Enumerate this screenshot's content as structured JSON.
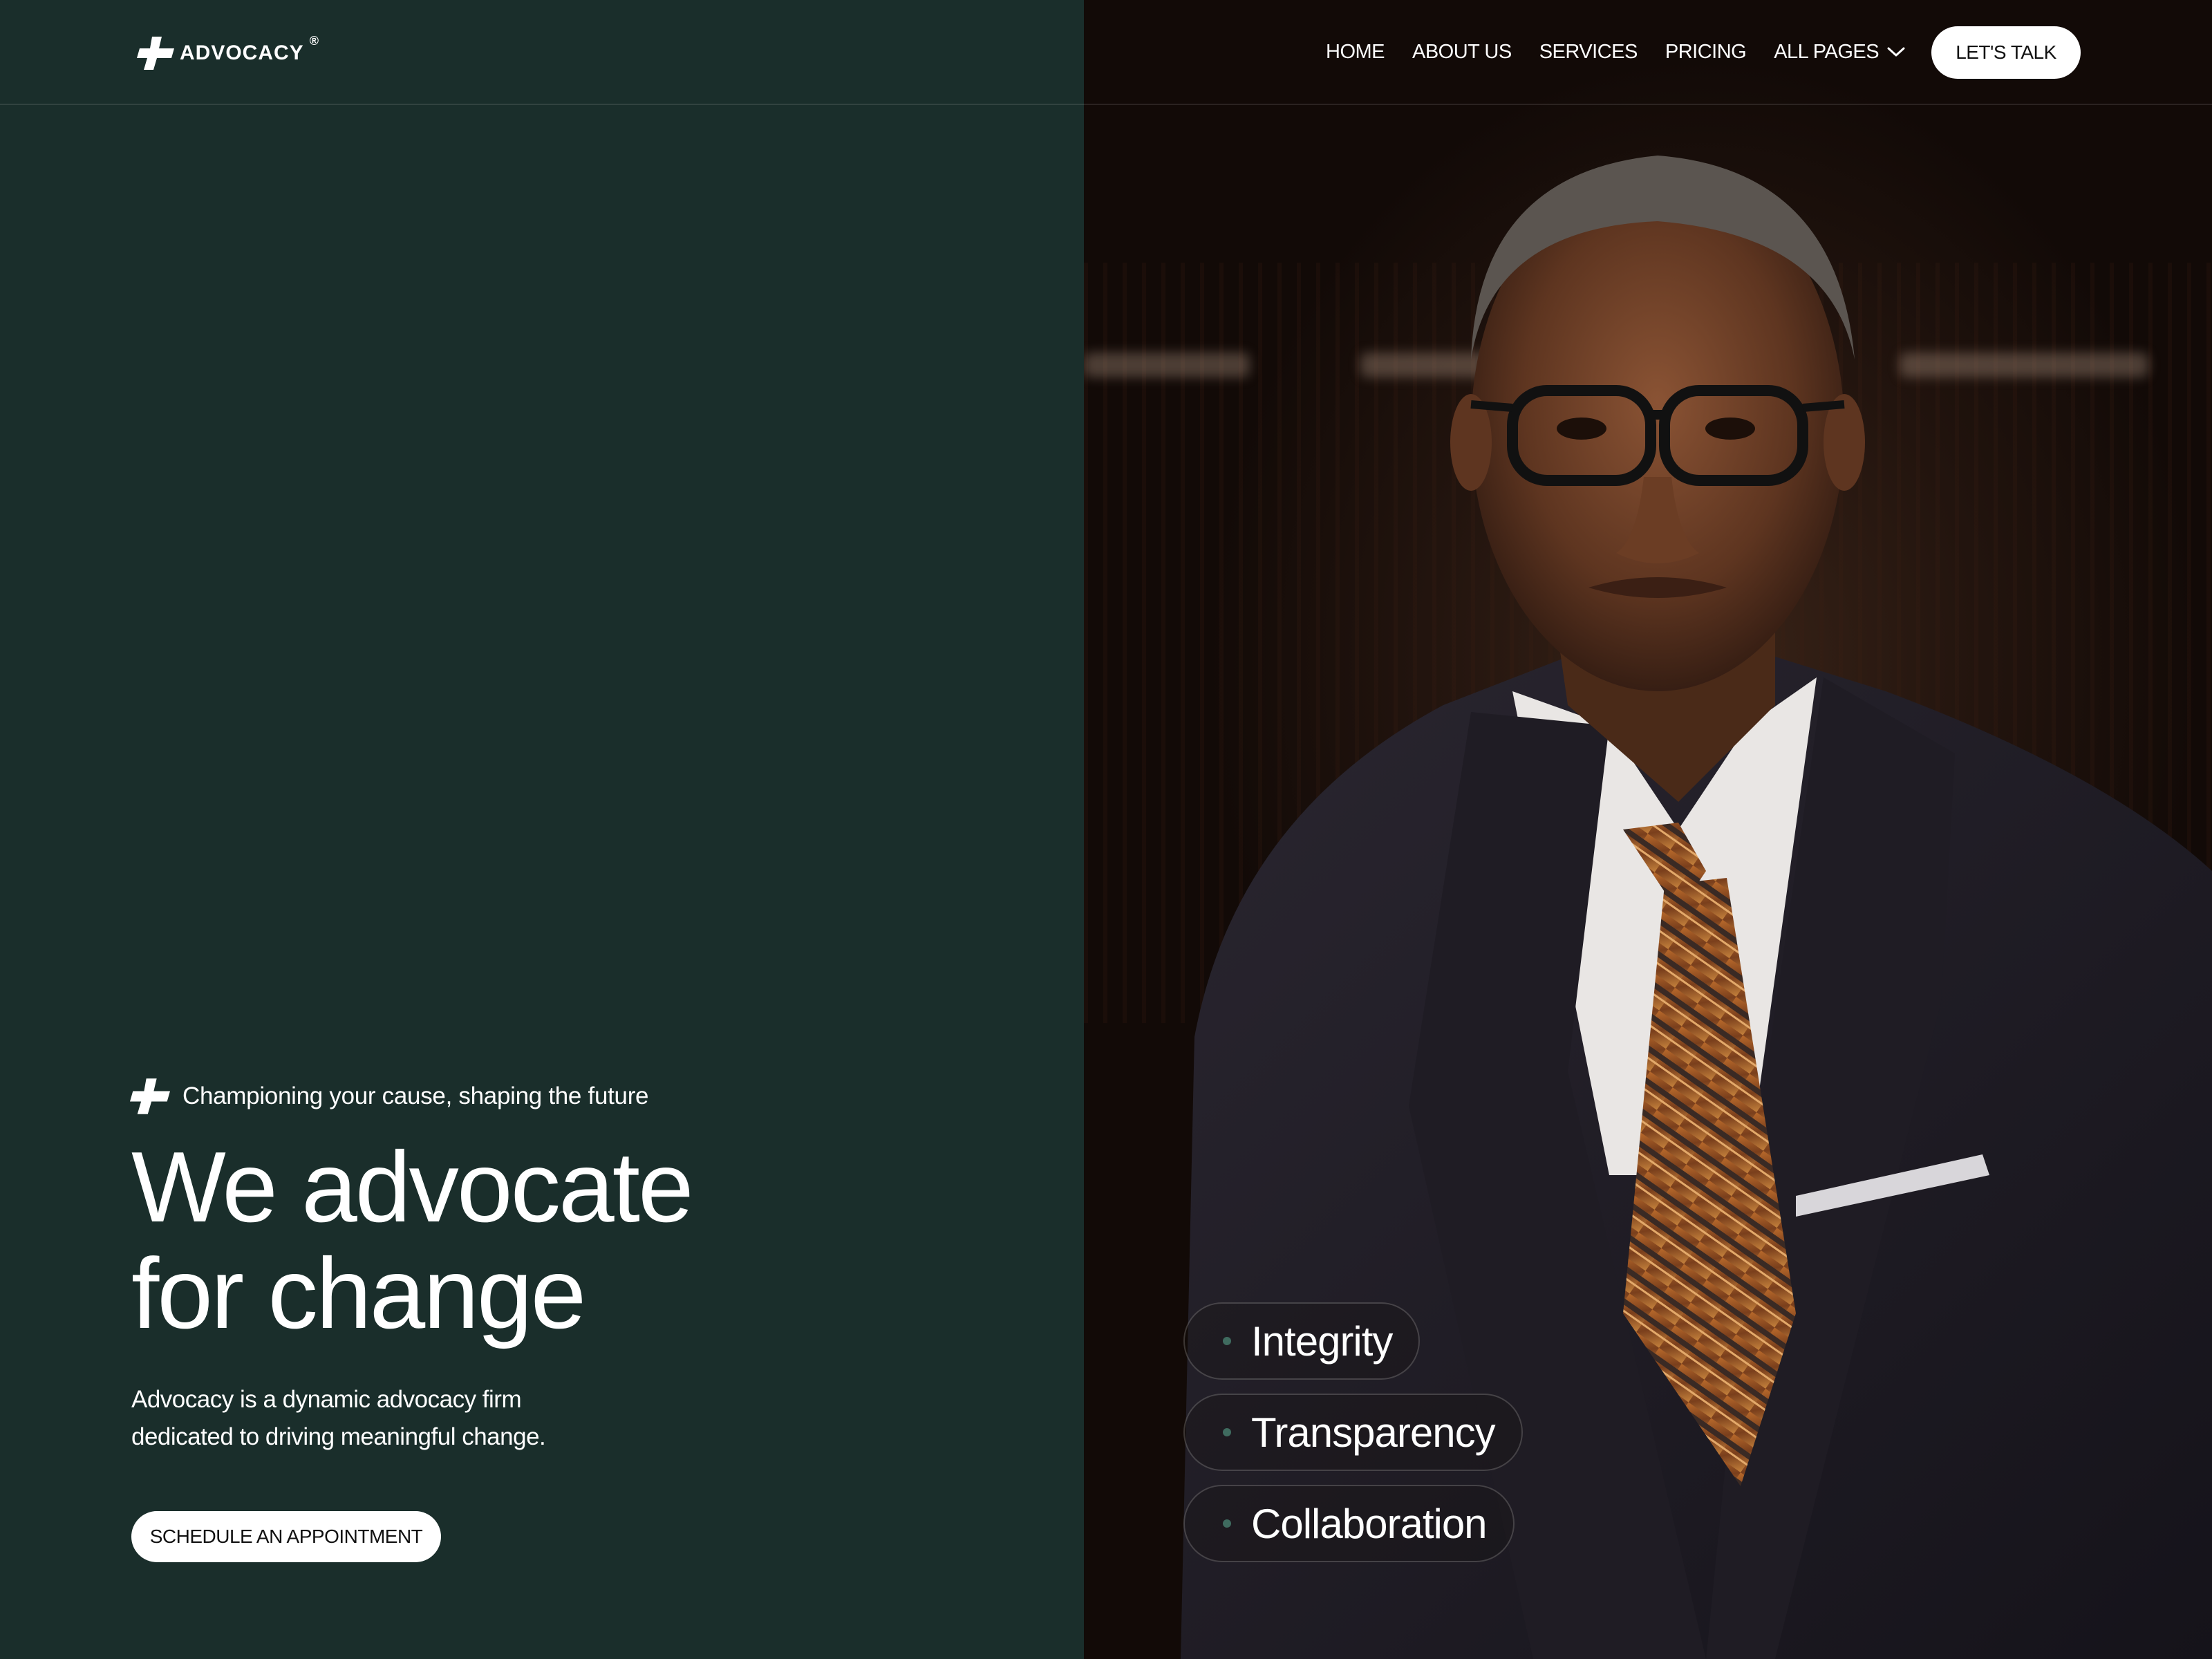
{
  "brand": {
    "name": "ADVOCACY",
    "registered": "®"
  },
  "nav": {
    "items": [
      {
        "label": "HOME"
      },
      {
        "label": "ABOUT US"
      },
      {
        "label": "SERVICES"
      },
      {
        "label": "PRICING"
      },
      {
        "label": "ALL PAGES",
        "dropdown_icon": "chevron-down-icon"
      }
    ],
    "cta_label": "LET'S TALK"
  },
  "hero": {
    "tagline": "Championing your cause, shaping the future",
    "title_line1": "We advocate",
    "title_line2": "for change",
    "desc_line1": "Advocacy is a dynamic advocacy firm",
    "desc_line2": "dedicated to driving meaningful change.",
    "button_label": "SCHEDULE AN APPOINTMENT"
  },
  "values": [
    {
      "label": "Integrity"
    },
    {
      "label": "Transparency"
    },
    {
      "label": "Collaboration"
    }
  ],
  "colors": {
    "panel_green": "#1a2e2b",
    "dot_green": "#3f6b5f",
    "button_bg": "#ffffff",
    "text": "#ffffff"
  }
}
